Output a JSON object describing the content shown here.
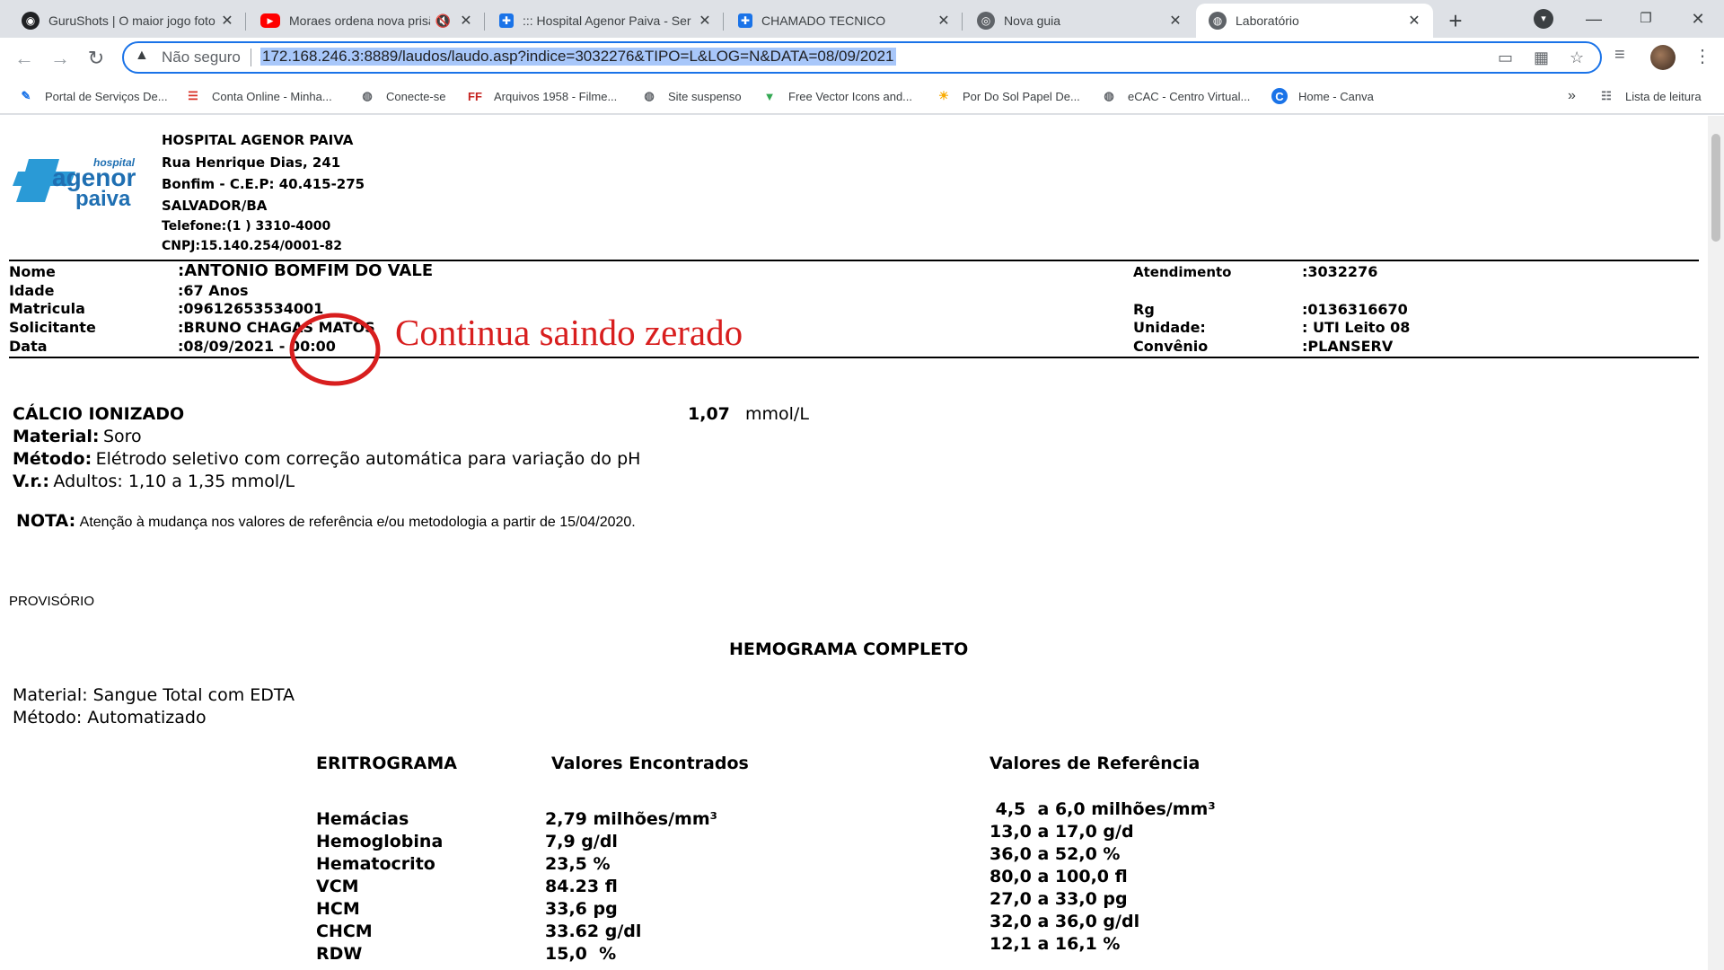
{
  "browser": {
    "tabs": [
      {
        "title": "GuruShots | O maior jogo foto",
        "favicon": "gurushots-icon",
        "color": "#202124"
      },
      {
        "title": "Moraes ordena nova prisã",
        "favicon": "youtube-icon",
        "color": "#ff0000",
        "audio": "🔇"
      },
      {
        "title": "::: Hospital Agenor Paiva - Ser",
        "favicon": "hospital-icon",
        "color": "#1a73e8"
      },
      {
        "title": "CHAMADO TECNICO",
        "favicon": "hospital-icon",
        "color": "#1a73e8"
      },
      {
        "title": "Nova guia",
        "favicon": "chrome-icon",
        "color": "#5f6368"
      },
      {
        "title": "Laboratório",
        "favicon": "globe-icon",
        "color": "#5f6368",
        "active": true
      }
    ],
    "omnibox": {
      "security_label": "Não seguro",
      "url": "172.168.246.3:8889/laudos/laudo.asp?indice=3032276&TIPO=L&LOG=N&DATA=08/09/2021"
    },
    "bookmarks": [
      {
        "label": "Portal de Serviços De...",
        "icon": "portal-icon"
      },
      {
        "label": "Conta Online - Minha...",
        "icon": "conta-icon"
      },
      {
        "label": "Conecte-se",
        "icon": "globe-icon"
      },
      {
        "label": "Arquivos 1958 - Filme...",
        "icon": "ff-icon"
      },
      {
        "label": "Site suspenso",
        "icon": "globe-icon"
      },
      {
        "label": "Free Vector Icons and...",
        "icon": "vector-icon"
      },
      {
        "label": "Por Do Sol Papel De...",
        "icon": "pordosol-icon"
      },
      {
        "label": "eCAC - Centro Virtual...",
        "icon": "globe-icon"
      },
      {
        "label": "Home - Canva",
        "icon": "canva-icon"
      }
    ],
    "overflow_label": "»",
    "reading_list_label": "Lista de leitura"
  },
  "hospital": {
    "name": "HOSPITAL AGENOR PAIVA",
    "street": "Rua Henrique Dias, 241",
    "district": "Bonfim - C.E.P: 40.415-275",
    "city": "SALVADOR/BA",
    "phone": "Telefone:(1 ) 3310-4000",
    "cnpj": "CNPJ:15.140.254/0001-82",
    "logo_words": [
      "hospital",
      "agenor",
      "paiva"
    ]
  },
  "patient": {
    "left": [
      {
        "label": "Nome",
        "value": ":ANTONIO BOMFIM DO VALE"
      },
      {
        "label": "Idade",
        "value": ":67  Anos"
      },
      {
        "label": "Matricula",
        "value": ":09612653534001"
      },
      {
        "label": "Solicitante",
        "value": ":BRUNO CHAGAS MATOS"
      },
      {
        "label": "Data",
        "value": ":08/09/2021 - 00:00"
      }
    ],
    "right": [
      {
        "label": "Atendimento",
        "value": ":3032276"
      },
      {
        "label": "Rg",
        "value": ":0136316670"
      },
      {
        "label": "Unidade:",
        "value": ": UTI Leito 08"
      },
      {
        "label": "Convênio",
        "value": ":PLANSERV"
      }
    ]
  },
  "annotation": {
    "text": "Continua saindo zerado",
    "color": "#d81e1e"
  },
  "calcio": {
    "title": "CÁLCIO IONIZADO",
    "value": "1,07",
    "unit": "mmol/L",
    "material_label": "Material:",
    "material_value": "Soro",
    "metodo_label": "Método:",
    "metodo_value": "Elétrodo seletivo com correção automática para variação do pH",
    "vr_label": "V.r.:",
    "vr_value": "Adultos: 1,10 a 1,35 mmol/L",
    "nota_label": "NOTA:",
    "nota_value": "Atenção à mudança nos valores de referência e/ou metodologia a partir de 15/04/2020."
  },
  "provisorio": "PROVISÓRIO",
  "hemograma": {
    "title": "HEMOGRAMA COMPLETO",
    "material": "Material: Sangue Total com EDTA",
    "metodo": "Método: Automatizado",
    "col_eritro": "ERITROGRAMA",
    "col_valores": "Valores Encontrados",
    "col_ref": "Valores de Referência",
    "rows": [
      {
        "name": "Hemácias",
        "value": "2,79 milhões/mm³",
        "ref": " 4,5  a 6,0 milhões/mm³"
      },
      {
        "name": "Hemoglobina",
        "value": "7,9 g/dl",
        "ref": "13,0 a 17,0 g/d"
      },
      {
        "name": "Hematocrito",
        "value": "23,5 %",
        "ref": "36,0 a 52,0 %"
      },
      {
        "name": "VCM",
        "value": "84.23 fl",
        "ref": "80,0 a 100,0 fl"
      },
      {
        "name": "HCM",
        "value": "33,6 pg",
        "ref": "27,0 a 33,0 pg"
      },
      {
        "name": "CHCM",
        "value": "33.62 g/dl",
        "ref": "32,0 a 36,0 g/dl"
      },
      {
        "name": "RDW",
        "value": "15,0  %",
        "ref": "12,1 a 16,1 %"
      }
    ]
  }
}
